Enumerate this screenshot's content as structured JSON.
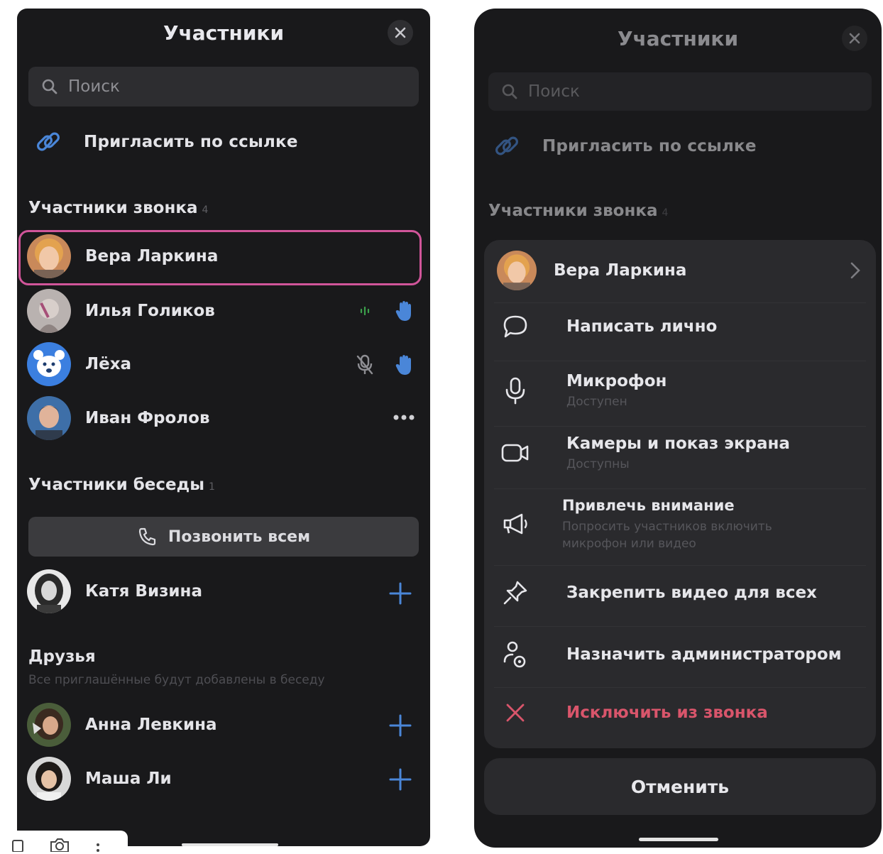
{
  "left": {
    "title": "Участники",
    "search_placeholder": "Поиск",
    "invite_label": "Пригласить по ссылке",
    "call_section": {
      "title": "Участники звонка",
      "count": "4"
    },
    "call_participants": [
      {
        "name": "Вера Ларкина"
      },
      {
        "name": "Илья Голиков"
      },
      {
        "name": "Лёха"
      },
      {
        "name": "Иван Фролов"
      }
    ],
    "chat_section": {
      "title": "Участники беседы",
      "count": "1"
    },
    "call_all_label": "Позвонить всем",
    "chat_participants": [
      {
        "name": "Катя Визина"
      }
    ],
    "friends_section": {
      "title": "Друзья",
      "subtitle": "Все приглашённые будут добавлены в беседу"
    },
    "friends": [
      {
        "name": "Анна Левкина"
      },
      {
        "name": "Маша Ли"
      }
    ]
  },
  "right": {
    "title": "Участники",
    "search_placeholder": "Поиск",
    "invite_label": "Пригласить по ссылке",
    "call_section": {
      "title": "Участники звонка",
      "count": "4"
    },
    "menu": {
      "user_name": "Вера Ларкина",
      "message_label": "Написать лично",
      "mic_label": "Микрофон",
      "mic_status": "Доступен",
      "camera_label": "Камеры и показ экрана",
      "camera_status": "Доступны",
      "attention_label": "Привлечь внимание",
      "attention_sub_1": "Попросить участников включить",
      "attention_sub_2": "микрофон или видео",
      "pin_label": "Закрепить видео для всех",
      "admin_label": "Назначить администратором",
      "remove_label": "Исключить из звонка"
    },
    "cancel_label": "Отменить"
  },
  "colors": {
    "background": "#19191b",
    "highlight": "#d1559a",
    "accent_blue": "#4a86d8",
    "danger": "#d9556b",
    "speaking_green": "#3ca04b"
  },
  "icons": [
    "search-icon",
    "link-icon",
    "close-icon",
    "raised-hand-icon",
    "mic-off-icon",
    "sound-wave-icon",
    "more-icon",
    "phone-icon",
    "add-icon",
    "chevron-right-icon",
    "message-icon",
    "mic-icon",
    "camera-icon",
    "megaphone-icon",
    "pin-icon",
    "admin-icon",
    "remove-icon"
  ]
}
